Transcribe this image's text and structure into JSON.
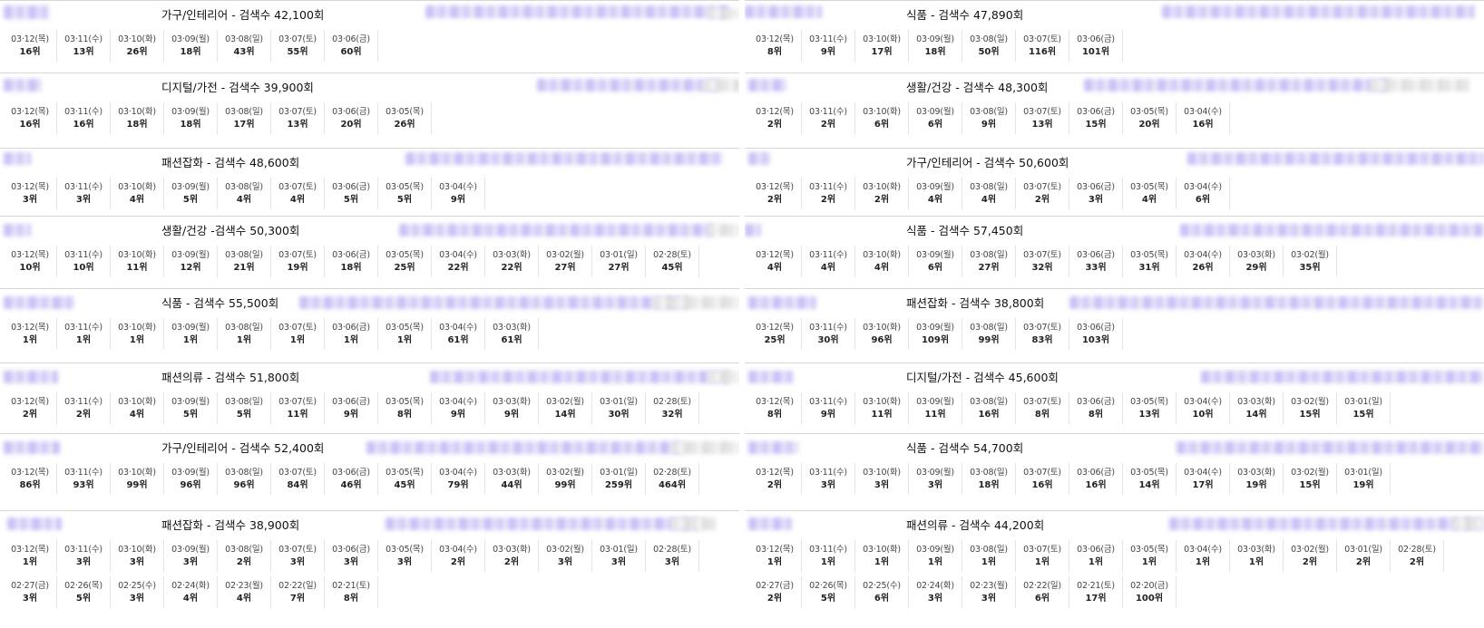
{
  "ui": {
    "rank_suffix": "위"
  },
  "cards": [
    {
      "category": "가구/인테리어",
      "sep": " - ",
      "count_label": "검색수",
      "count": "42,100회",
      "rows": [
        [
          [
            "03·12(목)",
            "16"
          ],
          [
            "03·11(수)",
            "13"
          ],
          [
            "03·10(화)",
            "26"
          ],
          [
            "03·09(월)",
            "18"
          ],
          [
            "03·08(일)",
            "43"
          ],
          [
            "03·07(토)",
            "55"
          ],
          [
            "03·06(금)",
            "60"
          ]
        ]
      ]
    },
    {
      "category": "식품",
      "sep": " - ",
      "count_label": "검색수",
      "count": "47,890회",
      "rows": [
        [
          [
            "03·12(목)",
            "8"
          ],
          [
            "03·11(수)",
            "9"
          ],
          [
            "03·10(화)",
            "17"
          ],
          [
            "03·09(월)",
            "18"
          ],
          [
            "03·08(일)",
            "50"
          ],
          [
            "03·07(토)",
            "116"
          ],
          [
            "03·06(금)",
            "101"
          ]
        ]
      ]
    },
    {
      "category": "디지털/가전",
      "sep": " - ",
      "count_label": "검색수",
      "count": "39,900회",
      "rows": [
        [
          [
            "03·12(목)",
            "16"
          ],
          [
            "03·11(수)",
            "16"
          ],
          [
            "03·10(화)",
            "18"
          ],
          [
            "03·09(월)",
            "18"
          ],
          [
            "03·08(일)",
            "17"
          ],
          [
            "03·07(토)",
            "13"
          ],
          [
            "03·06(금)",
            "20"
          ],
          [
            "03·05(목)",
            "26"
          ]
        ]
      ]
    },
    {
      "category": "생활/건강",
      "sep": " - ",
      "count_label": "검색수",
      "count": "48,300회",
      "rows": [
        [
          [
            "03·12(목)",
            "2"
          ],
          [
            "03·11(수)",
            "2"
          ],
          [
            "03·10(화)",
            "6"
          ],
          [
            "03·09(월)",
            "6"
          ],
          [
            "03·08(일)",
            "9"
          ],
          [
            "03·07(토)",
            "13"
          ],
          [
            "03·06(금)",
            "15"
          ],
          [
            "03·05(목)",
            "20"
          ],
          [
            "03·04(수)",
            "16"
          ]
        ]
      ]
    },
    {
      "category": "패션잡화",
      "sep": " - ",
      "count_label": "검색수",
      "count": "48,600회",
      "rows": [
        [
          [
            "03·12(목)",
            "3"
          ],
          [
            "03·11(수)",
            "3"
          ],
          [
            "03·10(화)",
            "4"
          ],
          [
            "03·09(월)",
            "5"
          ],
          [
            "03·08(일)",
            "4"
          ],
          [
            "03·07(토)",
            "4"
          ],
          [
            "03·06(금)",
            "5"
          ],
          [
            "03·05(목)",
            "5"
          ],
          [
            "03·04(수)",
            "9"
          ]
        ]
      ]
    },
    {
      "category": "가구/인테리어",
      "sep": " - ",
      "count_label": "검색수",
      "count": "50,600회",
      "rows": [
        [
          [
            "03·12(목)",
            "2"
          ],
          [
            "03·11(수)",
            "2"
          ],
          [
            "03·10(화)",
            "2"
          ],
          [
            "03·09(월)",
            "4"
          ],
          [
            "03·08(일)",
            "4"
          ],
          [
            "03·07(토)",
            "2"
          ],
          [
            "03·06(금)",
            "3"
          ],
          [
            "03·05(목)",
            "4"
          ],
          [
            "03·04(수)",
            "6"
          ]
        ]
      ]
    },
    {
      "category": "생활/건강",
      "sep": " -",
      "count_label": "검색수",
      "count": "50,300회",
      "rows": [
        [
          [
            "03·12(목)",
            "10"
          ],
          [
            "03·11(수)",
            "10"
          ],
          [
            "03·10(화)",
            "11"
          ],
          [
            "03·09(월)",
            "12"
          ],
          [
            "03·08(일)",
            "21"
          ],
          [
            "03·07(토)",
            "19"
          ],
          [
            "03·06(금)",
            "18"
          ],
          [
            "03·05(목)",
            "25"
          ],
          [
            "03·04(수)",
            "22"
          ],
          [
            "03·03(화)",
            "22"
          ],
          [
            "03·02(월)",
            "27"
          ],
          [
            "03·01(일)",
            "27"
          ],
          [
            "02·28(토)",
            "45"
          ]
        ]
      ]
    },
    {
      "category": "식품",
      "sep": " - ",
      "count_label": "검색수",
      "count": "57,450회",
      "rows": [
        [
          [
            "03·12(목)",
            "4"
          ],
          [
            "03·11(수)",
            "4"
          ],
          [
            "03·10(화)",
            "4"
          ],
          [
            "03·09(월)",
            "6"
          ],
          [
            "03·08(일)",
            "27"
          ],
          [
            "03·07(토)",
            "32"
          ],
          [
            "03·06(금)",
            "33"
          ],
          [
            "03·05(목)",
            "31"
          ],
          [
            "03·04(수)",
            "26"
          ],
          [
            "03·03(화)",
            "29"
          ],
          [
            "03·02(월)",
            "35"
          ]
        ]
      ]
    },
    {
      "category": "식품",
      "sep": " - ",
      "count_label": "검색수",
      "count": "55,500회",
      "rows": [
        [
          [
            "03·12(목)",
            "1"
          ],
          [
            "03·11(수)",
            "1"
          ],
          [
            "03·10(화)",
            "1"
          ],
          [
            "03·09(월)",
            "1"
          ],
          [
            "03·08(일)",
            "1"
          ],
          [
            "03·07(토)",
            "1"
          ],
          [
            "03·06(금)",
            "1"
          ],
          [
            "03·05(목)",
            "1"
          ],
          [
            "03·04(수)",
            "61"
          ],
          [
            "03·03(화)",
            "61"
          ]
        ]
      ]
    },
    {
      "category": "패션잡화",
      "sep": " - ",
      "count_label": "검색수",
      "count": "38,800회",
      "rows": [
        [
          [
            "03·12(목)",
            "25"
          ],
          [
            "03·11(수)",
            "30"
          ],
          [
            "03·10(화)",
            "96"
          ],
          [
            "03·09(월)",
            "109"
          ],
          [
            "03·08(일)",
            "99"
          ],
          [
            "03·07(토)",
            "83"
          ],
          [
            "03·06(금)",
            "103"
          ]
        ]
      ]
    },
    {
      "category": "패션의류",
      "sep": " - ",
      "count_label": "검색수",
      "count": "51,800회",
      "rows": [
        [
          [
            "03·12(목)",
            "2"
          ],
          [
            "03·11(수)",
            "2"
          ],
          [
            "03·10(화)",
            "4"
          ],
          [
            "03·09(월)",
            "5"
          ],
          [
            "03·08(일)",
            "5"
          ],
          [
            "03·07(토)",
            "11"
          ],
          [
            "03·06(금)",
            "9"
          ],
          [
            "03·05(목)",
            "8"
          ],
          [
            "03·04(수)",
            "9"
          ],
          [
            "03·03(화)",
            "9"
          ],
          [
            "03·02(월)",
            "14"
          ],
          [
            "03·01(일)",
            "30"
          ],
          [
            "02·28(토)",
            "32"
          ]
        ]
      ]
    },
    {
      "category": "디지털/가전",
      "sep": " - ",
      "count_label": "검색수",
      "count": "45,600회",
      "rows": [
        [
          [
            "03·12(목)",
            "8"
          ],
          [
            "03·11(수)",
            "9"
          ],
          [
            "03·10(화)",
            "11"
          ],
          [
            "03·09(월)",
            "11"
          ],
          [
            "03·08(일)",
            "16"
          ],
          [
            "03·07(토)",
            "8"
          ],
          [
            "03·06(금)",
            "8"
          ],
          [
            "03·05(목)",
            "13"
          ],
          [
            "03·04(수)",
            "10"
          ],
          [
            "03·03(화)",
            "14"
          ],
          [
            "03·02(월)",
            "15"
          ],
          [
            "03·01(일)",
            "15"
          ]
        ]
      ]
    },
    {
      "category": "가구/인테리어",
      "sep": " - ",
      "count_label": "검색수",
      "count": "52,400회",
      "rows": [
        [
          [
            "03·12(목)",
            "86"
          ],
          [
            "03·11(수)",
            "93"
          ],
          [
            "03·10(화)",
            "99"
          ],
          [
            "03·09(월)",
            "96"
          ],
          [
            "03·08(일)",
            "96"
          ],
          [
            "03·07(토)",
            "84"
          ],
          [
            "03·06(금)",
            "46"
          ],
          [
            "03·05(목)",
            "45"
          ],
          [
            "03·04(수)",
            "79"
          ],
          [
            "03·03(화)",
            "44"
          ],
          [
            "03·02(월)",
            "99"
          ],
          [
            "03·01(일)",
            "259"
          ],
          [
            "02·28(토)",
            "464"
          ]
        ]
      ]
    },
    {
      "category": "식품",
      "sep": " - ",
      "count_label": "검색수",
      "count": "54,700회",
      "rows": [
        [
          [
            "03·12(목)",
            "2"
          ],
          [
            "03·11(수)",
            "3"
          ],
          [
            "03·10(화)",
            "3"
          ],
          [
            "03·09(월)",
            "3"
          ],
          [
            "03·08(일)",
            "18"
          ],
          [
            "03·07(토)",
            "16"
          ],
          [
            "03·06(금)",
            "16"
          ],
          [
            "03·05(목)",
            "14"
          ],
          [
            "03·04(수)",
            "17"
          ],
          [
            "03·03(화)",
            "19"
          ],
          [
            "03·02(월)",
            "15"
          ],
          [
            "03·01(일)",
            "19"
          ]
        ]
      ]
    },
    {
      "category": "패션잡화",
      "sep": " - ",
      "count_label": "검색수",
      "count": "38,900회",
      "rows": [
        [
          [
            "03·12(목)",
            "1"
          ],
          [
            "03·11(수)",
            "3"
          ],
          [
            "03·10(화)",
            "3"
          ],
          [
            "03·09(월)",
            "3"
          ],
          [
            "03·08(일)",
            "2"
          ],
          [
            "03·07(토)",
            "3"
          ],
          [
            "03·06(금)",
            "3"
          ],
          [
            "03·05(목)",
            "3"
          ],
          [
            "03·04(수)",
            "2"
          ],
          [
            "03·03(화)",
            "2"
          ],
          [
            "03·02(월)",
            "3"
          ],
          [
            "03·01(일)",
            "3"
          ],
          [
            "02·28(토)",
            "3"
          ]
        ],
        [
          [
            "02·27(금)",
            "3"
          ],
          [
            "02·26(목)",
            "5"
          ],
          [
            "02·25(수)",
            "3"
          ],
          [
            "02·24(화)",
            "4"
          ],
          [
            "02·23(월)",
            "4"
          ],
          [
            "02·22(일)",
            "7"
          ],
          [
            "02·21(토)",
            "8"
          ]
        ]
      ]
    },
    {
      "category": "패션의류",
      "sep": " - ",
      "count_label": "검색수",
      "count": "44,200회",
      "rows": [
        [
          [
            "03·12(목)",
            "1"
          ],
          [
            "03·11(수)",
            "1"
          ],
          [
            "03·10(화)",
            "1"
          ],
          [
            "03·09(월)",
            "1"
          ],
          [
            "03·08(일)",
            "1"
          ],
          [
            "03·07(토)",
            "1"
          ],
          [
            "03·06(금)",
            "1"
          ],
          [
            "03·05(목)",
            "1"
          ],
          [
            "03·04(수)",
            "1"
          ],
          [
            "03·03(화)",
            "1"
          ],
          [
            "03·02(월)",
            "2"
          ],
          [
            "03·01(일)",
            "2"
          ],
          [
            "02·28(토)",
            "2"
          ]
        ],
        [
          [
            "02·27(금)",
            "2"
          ],
          [
            "02·26(목)",
            "5"
          ],
          [
            "02·25(수)",
            "6"
          ],
          [
            "02·24(화)",
            "3"
          ],
          [
            "02·23(월)",
            "3"
          ],
          [
            "02·22(일)",
            "6"
          ],
          [
            "02·21(토)",
            "17"
          ],
          [
            "02·20(금)",
            "100"
          ]
        ]
      ]
    }
  ]
}
